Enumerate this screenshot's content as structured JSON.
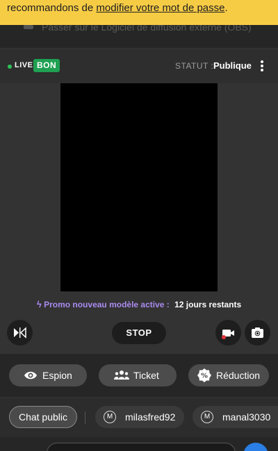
{
  "banner": {
    "text_before": "recommandons de ",
    "link": "modifier votre mot de passe",
    "text_after": "."
  },
  "ghost": {
    "text": "Passer sur le Logiciel de diffusion externe (OBS)"
  },
  "header": {
    "live_label": "LIVE",
    "quality_badge": "BON",
    "status_label": "STATUT :",
    "status_value": "Publique"
  },
  "promo": {
    "text": "Promo nouveau modèle active :",
    "days": "12 jours restants"
  },
  "controls": {
    "stop_label": "STOP"
  },
  "actions": {
    "spy_label": "Espion",
    "ticket_label": "Ticket",
    "discount_label": "Réduction"
  },
  "chat_tabs": {
    "public_label": "Chat public",
    "users": [
      {
        "initial": "M",
        "name": "milasfred92"
      },
      {
        "initial": "M",
        "name": "manal3030"
      }
    ]
  },
  "colors": {
    "live": "#2fc15a",
    "badge": "#1fa052",
    "promo": "#a98bf0",
    "banner": "#f7cc45",
    "send": "#2a7ee6"
  }
}
